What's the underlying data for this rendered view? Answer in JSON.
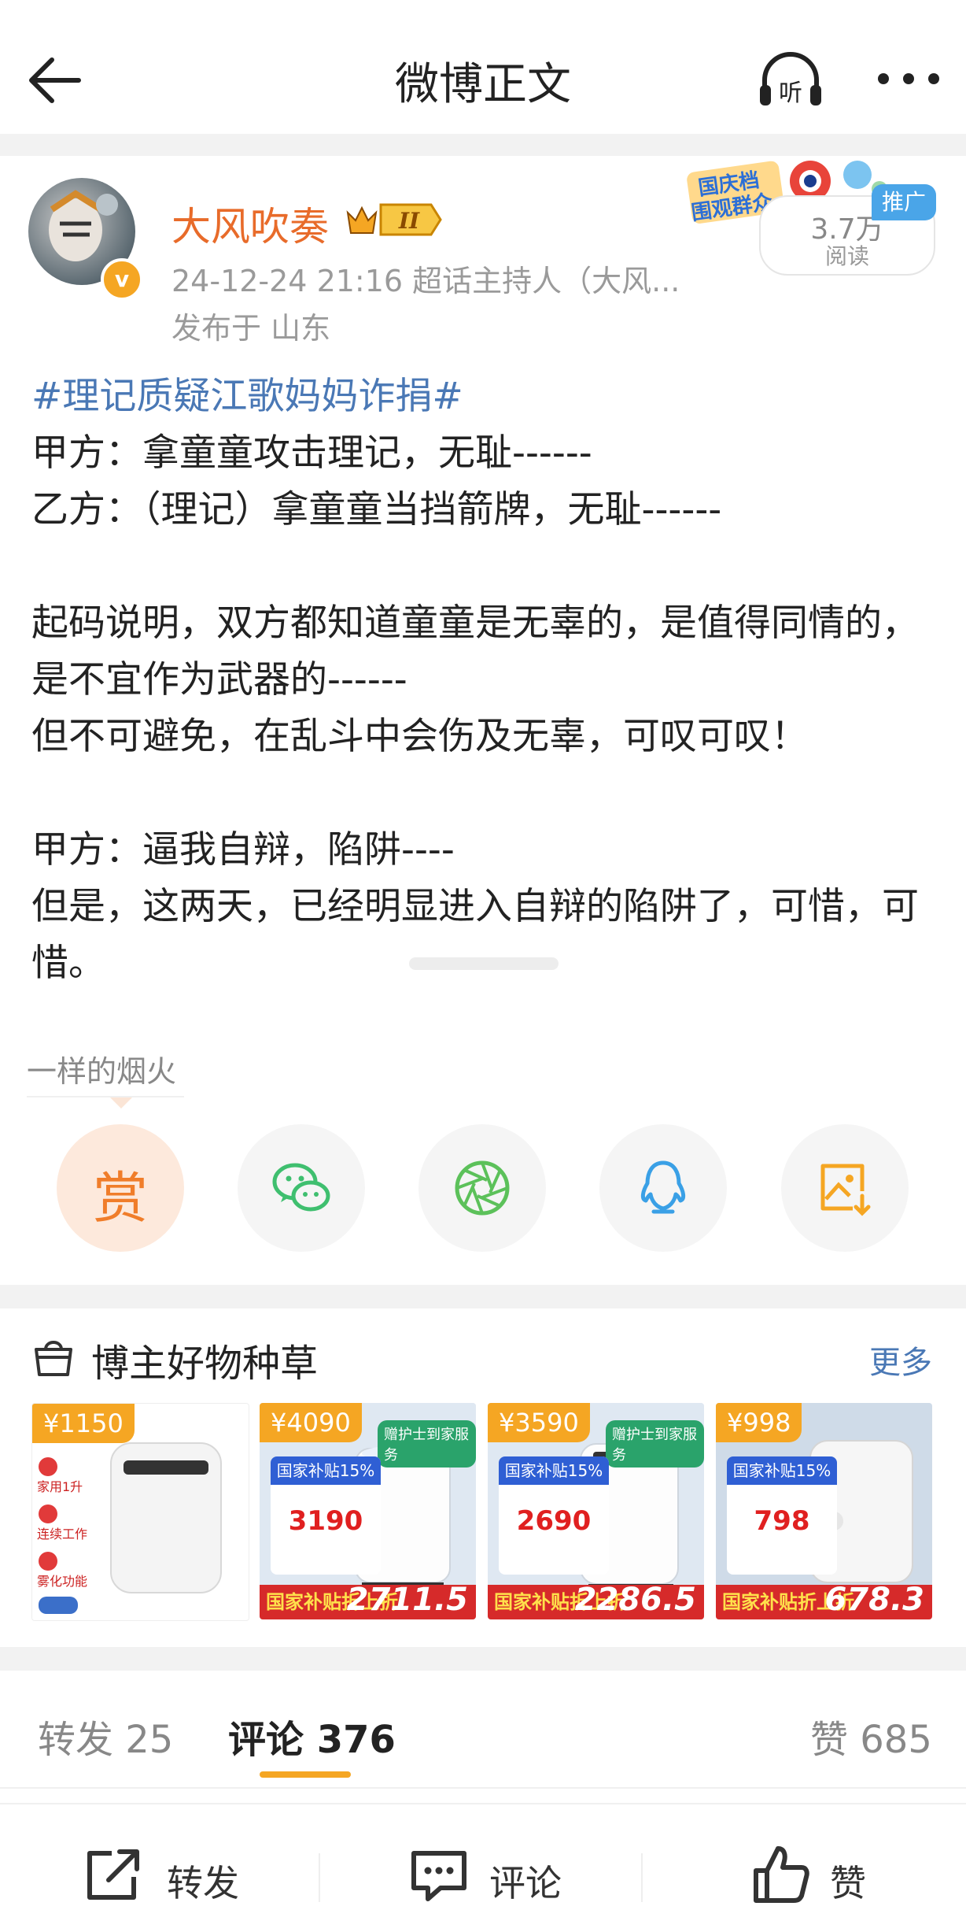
{
  "header": {
    "title": "微博正文",
    "listen_label": "听"
  },
  "author": {
    "name": "大风吹奏",
    "level_badge": "II",
    "meta": "24-12-24 21:16  超话主持人（大风...",
    "location": "发布于 山东",
    "verified_mark": "v"
  },
  "promo": {
    "banner_text_line1": "国庆档",
    "banner_text_line2": "围观群众",
    "read_count": "3.7万",
    "read_label": "阅读",
    "tag": "推广"
  },
  "post": {
    "hashtag": "#理记质疑江歌妈妈诈捐#",
    "text": "甲方：拿童童攻击理记，无耻------\n乙方：（理记）拿童童当挡箭牌，无耻------\n\n起码说明，双方都知道童童是无辜的，是值得同情的，是不宜作为武器的------\n但不可避免，在乱斗中会伤及无辜，可叹可叹！\n\n甲方：逼我自辩，陷阱----\n但是，这两天，已经明显进入自辩的陷阱了，可惜，可惜。"
  },
  "reward": {
    "caption": "一样的烟火",
    "reward_label": "赏"
  },
  "share_icons": [
    "reward-icon",
    "wechat-icon",
    "moments-icon",
    "qq-icon",
    "save-image-icon"
  ],
  "goods": {
    "title": "博主好物种草",
    "more": "更多",
    "products": [
      {
        "price": "¥1150",
        "labels": [
          "家用1升",
          "连续工作",
          "雾化功能"
        ]
      },
      {
        "price": "¥4090",
        "badge": "赠护士到家服务",
        "subsidy_head": "国家补贴15%",
        "subsidy_price": "3190",
        "bottom_text": "国家补贴折上折",
        "final_price": "2711.5"
      },
      {
        "price": "¥3590",
        "badge": "赠护士到家服务",
        "subsidy_head": "国家补贴15%",
        "subsidy_price": "2690",
        "bottom_text": "国家补贴折上折",
        "final_price": "2286.5"
      },
      {
        "price": "¥998",
        "subsidy_head": "国家补贴15%",
        "subsidy_price": "798",
        "bottom_text": "国家补贴折上折",
        "final_price": "678.3"
      }
    ]
  },
  "tabs": {
    "repost": "转发 25",
    "comment": "评论 376",
    "like": "赞 685"
  },
  "actions": {
    "repost": "转发",
    "comment": "评论",
    "like": "赞"
  },
  "colors": {
    "accent_orange": "#f5a623",
    "author_name": "#e86b2a",
    "link_blue": "#4a78b5",
    "wechat_green": "#3fbf6f",
    "qq_blue": "#3aa0e6"
  }
}
